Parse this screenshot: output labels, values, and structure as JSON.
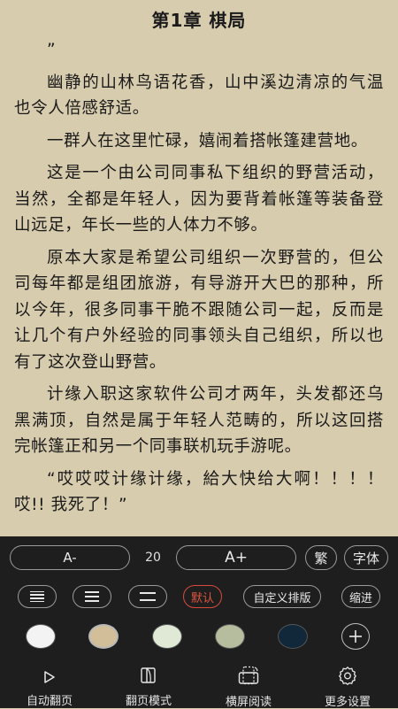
{
  "reader": {
    "chapter_title": "第1章 棋局",
    "paragraphs": [
      "”",
      "幽静的山林鸟语花香，山中溪边清凉的气温也令人倍感舒适。",
      "一群人在这里忙碌，嬉闹着搭帐篷建营地。",
      "这是一个由公司同事私下组织的野营活动，当然，全都是年轻人，因为要背着帐篷等装备登山远足，年长一些的人体力不够。",
      "原本大家是希望公司组织一次野营的，但公司每年都是组团旅游，有导游开大巴的那种，所以今年，很多同事干脆不跟随公司一起，反而是让几个有户外经验的同事领头自己组织，所以也有了这次登山野营。",
      "计缘入职这家软件公司才两年，头发都还乌黑满顶，自然是属于年轻人范畴的，所以这回搭完帐篷正和另一个同事联机玩手游呢。",
      "“哎哎哎计缘计缘，給大快给大啊！！！！哎!! 我死了！”"
    ]
  },
  "settings": {
    "font_decrease_label": "A-",
    "font_size": "20",
    "font_increase_label": "A+",
    "traditional_label": "繁",
    "font_label": "字体",
    "default_layout_label": "默认",
    "custom_layout_label": "自定义排版",
    "indent_label": "缩进",
    "theme_colors": [
      "#f3f3f3",
      "#d2bf99",
      "#dfe9d6",
      "#b6bd9f",
      "#10283a"
    ],
    "selected_theme_index": 1,
    "accent_color": "#e0553f"
  },
  "tabbar": {
    "auto_page_label": "自动翻页",
    "page_mode_label": "翻页模式",
    "landscape_label": "横屏阅读",
    "more_settings_label": "更多设置"
  },
  "icons": {
    "auto_page": "play-triangle-icon",
    "page_mode": "page-flip-icon",
    "landscape": "rotate-screen-icon",
    "more_settings": "gear-icon",
    "add_theme": "plus-icon"
  }
}
